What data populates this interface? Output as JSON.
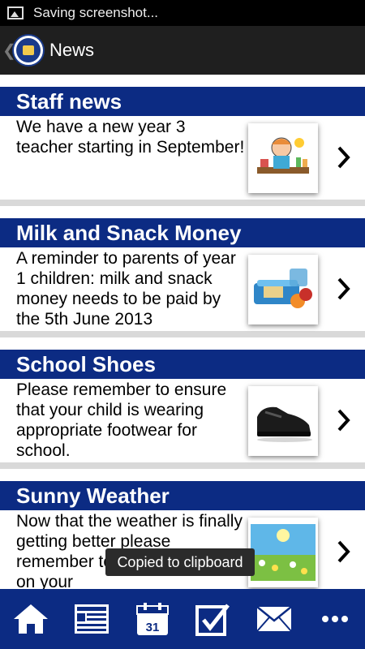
{
  "status_bar": {
    "text": "Saving screenshot..."
  },
  "action_bar": {
    "back_glyph": "❮",
    "title": "News"
  },
  "news": [
    {
      "title": "Staff news",
      "body": "We have a new year 3 teacher starting in September!",
      "thumb_icon": "teacher-clipart"
    },
    {
      "title": "Milk and Snack Money",
      "body": "A reminder to parents of year 1 children: milk and snack money needs to be paid by the 5th June 2013",
      "thumb_icon": "lunchbox-photo"
    },
    {
      "title": "School Shoes",
      "body": "Please remember to ensure that your child is wearing appropriate footwear for school.",
      "thumb_icon": "school-shoe-photo"
    },
    {
      "title": "Sunny Weather",
      "body": "Now that the weather is finally getting better please remember to put sunscreen on your",
      "thumb_icon": "sunny-field-photo"
    }
  ],
  "toast": {
    "text": "Copied to clipboard"
  },
  "tabbar": {
    "items": [
      {
        "icon": "home-icon"
      },
      {
        "icon": "newsletter-icon"
      },
      {
        "icon": "calendar-icon",
        "calendar_day": "31"
      },
      {
        "icon": "checklist-icon"
      },
      {
        "icon": "mail-icon"
      },
      {
        "icon": "more-icon"
      }
    ]
  },
  "colors": {
    "header_blue": "#0c2b83",
    "background_gray": "#d9d9d9"
  }
}
